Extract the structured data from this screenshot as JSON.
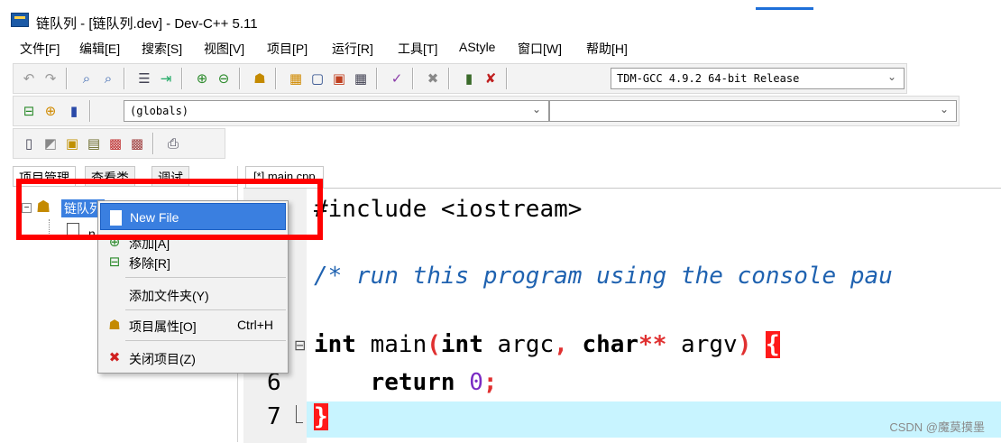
{
  "window": {
    "title": "链队列 - [链队列.dev] - Dev-C++ 5.11"
  },
  "menubar": {
    "items": [
      "文件[F]",
      "编辑[E]",
      "搜索[S]",
      "视图[V]",
      "项目[P]",
      "运行[R]",
      "工具[T]",
      "AStyle",
      "窗口[W]",
      "帮助[H]"
    ]
  },
  "toolbar": {
    "compiler_select": "TDM-GCC 4.9.2 64-bit Release",
    "scope_select": "(globals)"
  },
  "left_panel": {
    "tabs": [
      "项目管理",
      "查看类",
      "调试"
    ],
    "project_name": "链队列",
    "child_partial": "n"
  },
  "editor": {
    "tab_label": "[*] main.cpp",
    "line_numbers": [
      "6",
      "7"
    ],
    "code": {
      "line1": "#include <iostream>",
      "line2": "/* run this program using the console pau",
      "line3_kw1": "int",
      "line3_mid1": " main",
      "line3_paren_open": "(",
      "line3_kw2": "int",
      "line3_mid2": " argc",
      "line3_comma": ",",
      "line3_kw3": " char",
      "line3_stars": "**",
      "line3_mid3": " argv",
      "line3_paren_close": ")",
      "line3_brace": "{",
      "line4_kw": "return",
      "line4_num": "0",
      "line4_semi": ";",
      "line5_brace": "}"
    }
  },
  "context_menu": {
    "items": [
      {
        "label": "New File",
        "icon": "file-icon",
        "shortcut": ""
      },
      {
        "label": "添加[A]",
        "icon": "add-icon",
        "shortcut": ""
      },
      {
        "label": "移除[R]",
        "icon": "remove-icon",
        "shortcut": ""
      },
      {
        "label": "添加文件夹(Y)",
        "icon": "",
        "shortcut": ""
      },
      {
        "label": "项目属性[O]",
        "icon": "properties-icon",
        "shortcut": "Ctrl+H"
      },
      {
        "label": "关闭项目(Z)",
        "icon": "close-project-icon",
        "shortcut": ""
      }
    ]
  },
  "watermark": "CSDN @魔莫摸墨",
  "colors": {
    "highlight": "#3a7fe0",
    "annotation": "#ff0000",
    "current_line": "#c8f4ff"
  }
}
